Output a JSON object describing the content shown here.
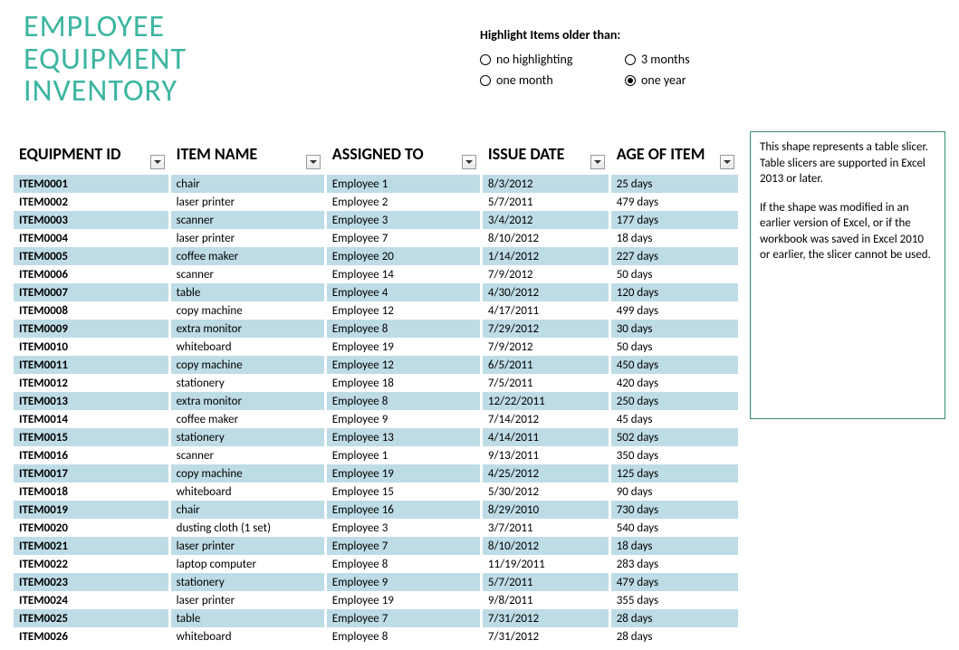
{
  "title_line1": "EMPLOYEE",
  "title_line2": "EQUIPMENT",
  "title_line3": "INVENTORY",
  "highlight": {
    "label": "Highlight Items older than:",
    "options": [
      {
        "label": "no highlighting",
        "selected": false
      },
      {
        "label": "3 months",
        "selected": false
      },
      {
        "label": "one month",
        "selected": false
      },
      {
        "label": "one year",
        "selected": true
      }
    ]
  },
  "columns": {
    "c1": "EQUIPMENT ID",
    "c2": "ITEM NAME",
    "c3": "ASSIGNED TO",
    "c4": "ISSUE DATE",
    "c5": "AGE OF ITEM"
  },
  "rows": [
    {
      "id": "ITEM0001",
      "name": "chair",
      "assigned": "Employee 1",
      "date": "8/3/2012",
      "age": "25 days"
    },
    {
      "id": "ITEM0002",
      "name": "laser printer",
      "assigned": "Employee 2",
      "date": "5/7/2011",
      "age": "479 days"
    },
    {
      "id": "ITEM0003",
      "name": "scanner",
      "assigned": "Employee 3",
      "date": "3/4/2012",
      "age": "177 days"
    },
    {
      "id": "ITEM0004",
      "name": "laser printer",
      "assigned": "Employee 7",
      "date": "8/10/2012",
      "age": "18 days"
    },
    {
      "id": "ITEM0005",
      "name": "coffee maker",
      "assigned": "Employee 20",
      "date": "1/14/2012",
      "age": "227 days"
    },
    {
      "id": "ITEM0006",
      "name": "scanner",
      "assigned": "Employee 14",
      "date": "7/9/2012",
      "age": "50 days"
    },
    {
      "id": "ITEM0007",
      "name": "table",
      "assigned": "Employee 4",
      "date": "4/30/2012",
      "age": "120 days"
    },
    {
      "id": "ITEM0008",
      "name": "copy machine",
      "assigned": "Employee 12",
      "date": "4/17/2011",
      "age": "499 days"
    },
    {
      "id": "ITEM0009",
      "name": "extra monitor",
      "assigned": "Employee 8",
      "date": "7/29/2012",
      "age": "30 days"
    },
    {
      "id": "ITEM0010",
      "name": "whiteboard",
      "assigned": "Employee 19",
      "date": "7/9/2012",
      "age": "50 days"
    },
    {
      "id": "ITEM0011",
      "name": "copy machine",
      "assigned": "Employee 12",
      "date": "6/5/2011",
      "age": "450 days"
    },
    {
      "id": "ITEM0012",
      "name": "stationery",
      "assigned": "Employee 18",
      "date": "7/5/2011",
      "age": "420 days"
    },
    {
      "id": "ITEM0013",
      "name": "extra monitor",
      "assigned": "Employee 8",
      "date": "12/22/2011",
      "age": "250 days"
    },
    {
      "id": "ITEM0014",
      "name": "coffee maker",
      "assigned": "Employee 9",
      "date": "7/14/2012",
      "age": "45 days"
    },
    {
      "id": "ITEM0015",
      "name": "stationery",
      "assigned": "Employee 13",
      "date": "4/14/2011",
      "age": "502 days"
    },
    {
      "id": "ITEM0016",
      "name": "scanner",
      "assigned": "Employee 1",
      "date": "9/13/2011",
      "age": "350 days"
    },
    {
      "id": "ITEM0017",
      "name": "copy machine",
      "assigned": "Employee 19",
      "date": "4/25/2012",
      "age": "125 days"
    },
    {
      "id": "ITEM0018",
      "name": "whiteboard",
      "assigned": "Employee 15",
      "date": "5/30/2012",
      "age": "90 days"
    },
    {
      "id": "ITEM0019",
      "name": "chair",
      "assigned": "Employee 16",
      "date": "8/29/2010",
      "age": "730 days"
    },
    {
      "id": "ITEM0020",
      "name": "dusting cloth (1 set)",
      "assigned": "Employee 3",
      "date": "3/7/2011",
      "age": "540 days"
    },
    {
      "id": "ITEM0021",
      "name": "laser printer",
      "assigned": "Employee 7",
      "date": "8/10/2012",
      "age": "18 days"
    },
    {
      "id": "ITEM0022",
      "name": "laptop computer",
      "assigned": "Employee 8",
      "date": "11/19/2011",
      "age": "283 days"
    },
    {
      "id": "ITEM0023",
      "name": "stationery",
      "assigned": "Employee 9",
      "date": "5/7/2011",
      "age": "479 days"
    },
    {
      "id": "ITEM0024",
      "name": "laser printer",
      "assigned": "Employee 19",
      "date": "9/8/2011",
      "age": "355 days"
    },
    {
      "id": "ITEM0025",
      "name": "table",
      "assigned": "Employee 7",
      "date": "7/31/2012",
      "age": "28 days"
    },
    {
      "id": "ITEM0026",
      "name": "whiteboard",
      "assigned": "Employee 8",
      "date": "7/31/2012",
      "age": "28 days"
    }
  ],
  "slicer": {
    "p1": "This shape represents a table slicer. Table slicers are supported in Excel 2013 or later.",
    "p2": "If the shape was modified in an earlier version of Excel, or if the workbook was saved in Excel 2010 or earlier, the slicer cannot be used."
  }
}
